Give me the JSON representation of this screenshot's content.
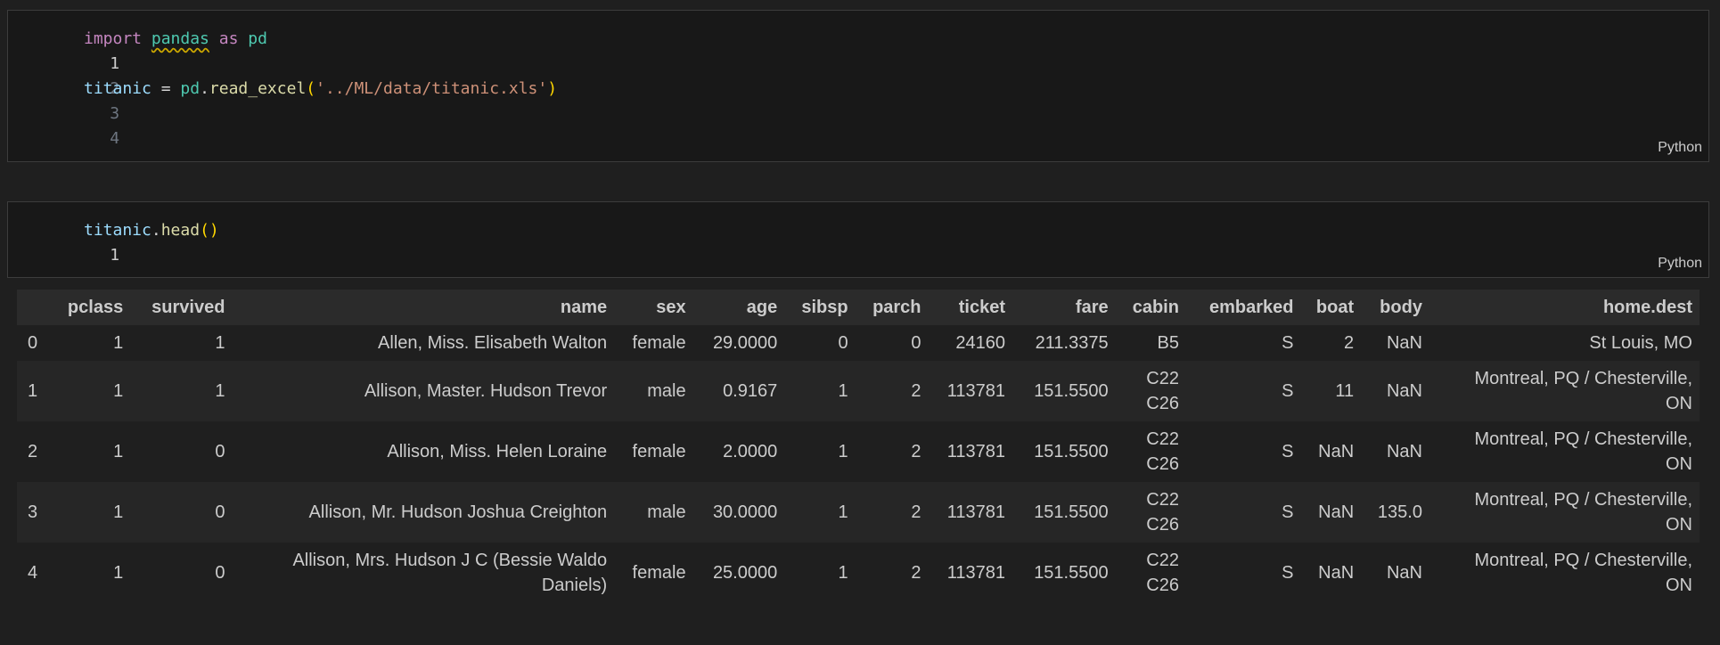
{
  "cell1": {
    "line_numbers": [
      "1",
      "2",
      "3",
      "4"
    ],
    "line1": {
      "kw_import": "import",
      "module": "pandas",
      "kw_as": "as",
      "alias": "pd"
    },
    "line3": {
      "var": "titanic",
      "eq": " = ",
      "obj": "pd",
      "dot": ".",
      "func": "read_excel",
      "lparen": "(",
      "str": "'../ML/data/titanic.xls'",
      "rparen": ")"
    },
    "language": "Python"
  },
  "cell2": {
    "line_numbers": [
      "1"
    ],
    "line1": {
      "var": "titanic",
      "dot": ".",
      "func": "head",
      "parens": "()"
    },
    "language": "Python"
  },
  "output": {
    "columns": [
      "",
      "pclass",
      "survived",
      "name",
      "sex",
      "age",
      "sibsp",
      "parch",
      "ticket",
      "fare",
      "cabin",
      "embarked",
      "boat",
      "body",
      "home.dest"
    ],
    "rows": [
      [
        "0",
        "1",
        "1",
        "Allen, Miss. Elisabeth Walton",
        "female",
        "29.0000",
        "0",
        "0",
        "24160",
        "211.3375",
        "B5",
        "S",
        "2",
        "NaN",
        "St Louis, MO"
      ],
      [
        "1",
        "1",
        "1",
        "Allison, Master. Hudson Trevor",
        "male",
        "0.9167",
        "1",
        "2",
        "113781",
        "151.5500",
        "C22\nC26",
        "S",
        "11",
        "NaN",
        "Montreal, PQ / Chesterville,\nON"
      ],
      [
        "2",
        "1",
        "0",
        "Allison, Miss. Helen Loraine",
        "female",
        "2.0000",
        "1",
        "2",
        "113781",
        "151.5500",
        "C22\nC26",
        "S",
        "NaN",
        "NaN",
        "Montreal, PQ / Chesterville,\nON"
      ],
      [
        "3",
        "1",
        "0",
        "Allison, Mr. Hudson Joshua Creighton",
        "male",
        "30.0000",
        "1",
        "2",
        "113781",
        "151.5500",
        "C22\nC26",
        "S",
        "NaN",
        "135.0",
        "Montreal, PQ / Chesterville,\nON"
      ],
      [
        "4",
        "1",
        "0",
        "Allison, Mrs. Hudson J C (Bessie Waldo\nDaniels)",
        "female",
        "25.0000",
        "1",
        "2",
        "113781",
        "151.5500",
        "C22\nC26",
        "S",
        "NaN",
        "NaN",
        "Montreal, PQ / Chesterville,\nON"
      ]
    ]
  },
  "colors": {
    "background": "#1f1f1f",
    "cell_bg": "#181818",
    "keyword": "#c586c0",
    "module": "#4ec9b0",
    "variable": "#9cdcfe",
    "function": "#dcdcaa",
    "string": "#ce9178",
    "bracket": "#ffd700",
    "warning_squiggle": "#cca700"
  }
}
